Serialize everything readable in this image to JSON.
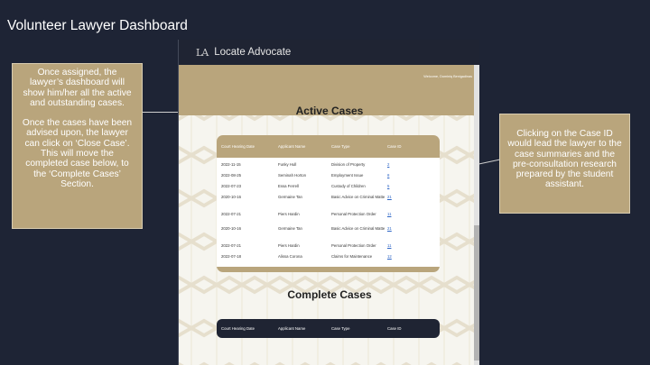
{
  "slide": {
    "title": "Volunteer Lawyer Dashboard",
    "callout_left_1": "Once assigned, the lawyer’s dashboard will show him/her all the active and outstanding cases.",
    "callout_left_2": "Once the cases have been advised upon, the lawyer can click on ‘Close Case’. This will move the completed case below, to the ‘Complete Cases’ Section.",
    "callout_right": "Clicking on the Case ID would lead the lawyer to the case summaries and the pre-consultation research prepared by the student assistant."
  },
  "app": {
    "logo": "LA",
    "name": "Locate Advocate",
    "welcome": "Welcome, Dominiq Benigadinas"
  },
  "active": {
    "title": "Active Cases",
    "headers": [
      "Court Hearing Date",
      "Applicant Name",
      "Case Type",
      "Case ID"
    ],
    "rows": [
      [
        "2022-11-15",
        "Funky Hull",
        "Division of Property",
        "2"
      ],
      [
        "2022-08-25",
        "Seminah Horton",
        "Employment Issue",
        "8"
      ],
      [
        "2022-07-23",
        "Essa Ferrell",
        "Custody of Children",
        "5"
      ],
      [
        "2020-10-16",
        "Germaine Tan",
        "Basic Advice on Criminal Matte",
        "21"
      ],
      [
        "2022-07-21",
        "Piers Hardin",
        "Personal Protection Order",
        "11"
      ],
      [
        "2020-10-16",
        "Germaine Tan",
        "Basic Advice on Criminal Matte",
        "21"
      ],
      [
        "2022-07-21",
        "Piers Hardin",
        "Personal Protection Order",
        "11"
      ],
      [
        "2022-07-18",
        "Alissa Corona",
        "Claims for Maintenance",
        "12"
      ]
    ]
  },
  "complete": {
    "title": "Complete Cases",
    "headers": [
      "Court Hearing Date",
      "Applicant Name",
      "Case Type",
      "Case ID"
    ]
  },
  "colors": {
    "background": "#1e2435",
    "accent": "#b9a57c",
    "header": "#1f2433",
    "link": "#2a63c6"
  }
}
